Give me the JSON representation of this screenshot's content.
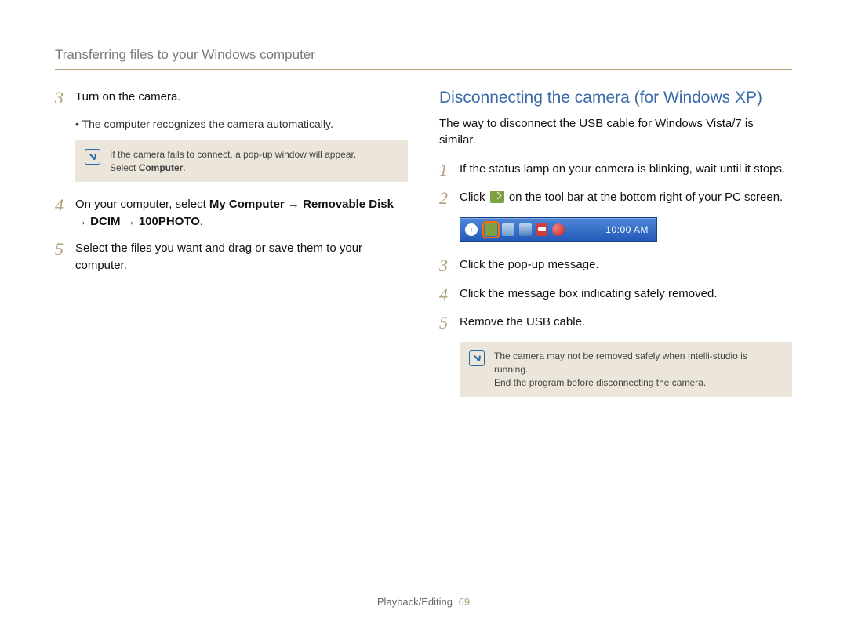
{
  "header": "Transferring files to your Windows computer",
  "left": {
    "step3_num": "3",
    "step3_text": "Turn on the camera.",
    "step3_bullet": "The computer recognizes the camera automatically.",
    "note1_line1": "If the camera fails to connect, a pop-up window will appear.",
    "note1_line2_prefix": "Select ",
    "note1_line2_bold": "Computer",
    "note1_line2_suffix": ".",
    "step4_num": "4",
    "step4_prefix": "On your computer, select ",
    "step4_bold": "My Computer → Removable Disk → DCIM → 100PHOTO",
    "step4_suffix": ".",
    "step5_num": "5",
    "step5_text": "Select the files you want and drag or save them to your computer."
  },
  "right": {
    "title": "Disconnecting the camera (for Windows XP)",
    "subtitle": "The way to disconnect the USB cable for Windows Vista/7 is similar.",
    "step1_num": "1",
    "step1_text": "If the status lamp on your camera is blinking, wait until it stops.",
    "step2_num": "2",
    "step2_prefix": "Click ",
    "step2_suffix": " on the tool bar at the bottom right of your PC screen.",
    "taskbar_clock": "10:00 AM",
    "step3_num": "3",
    "step3_text": "Click the pop-up message.",
    "step4_num": "4",
    "step4_text": "Click the message box indicating safely removed.",
    "step5_num": "5",
    "step5_text": "Remove the USB cable.",
    "note2_line1": "The camera may not be removed safely when Intelli-studio is running.",
    "note2_line2": "End the program before disconnecting the camera."
  },
  "footer": {
    "section": "Playback/Editing",
    "page": "69"
  }
}
